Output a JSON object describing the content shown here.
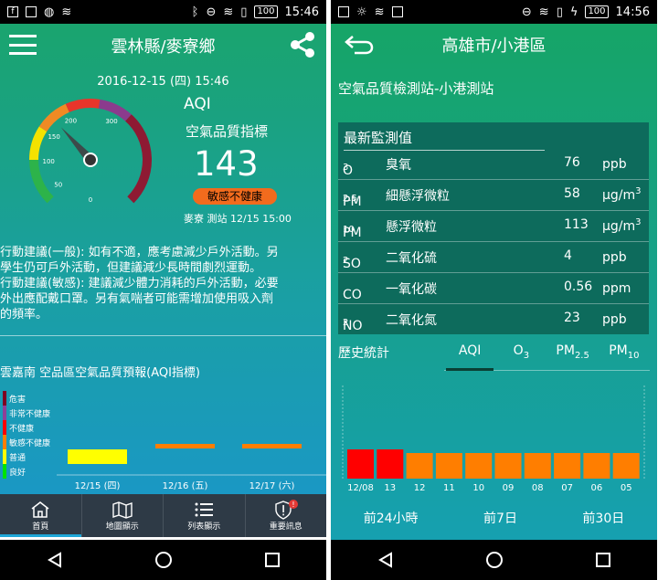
{
  "left": {
    "status": {
      "time": "15:46",
      "battery": "100"
    },
    "header": {
      "title": "雲林縣/麥寮鄉"
    },
    "datetime": "2016-12-15 (四) 15:46",
    "gauge": {
      "ticks": [
        "0",
        "50",
        "100",
        "150",
        "200",
        "300"
      ],
      "value": 143
    },
    "aqi": {
      "label": "AQI",
      "subtitle": "空氣品質指標",
      "value": "143",
      "badge": "敏感不健康",
      "station": "麥寮 測站 12/15 15:00"
    },
    "advice": [
      "行動建議(一般): 如有不適，應考慮減少戶外活動。另",
      "學生仍可戶外活動，但建議減少長時間劇烈運動。",
      "行動建議(敏感): 建議減少體力消耗的戶外活動，必要",
      "外出應配戴口罩。另有氣喘者可能需增加使用吸入劑",
      "的頻率。"
    ],
    "forecast": {
      "title": "雲嘉南 空品區空氣品質預報(AQI指標)",
      "legend": [
        "危害",
        "非常不健康",
        "不健康",
        "敏感不健康",
        "普通",
        "良好"
      ],
      "legend_colors": [
        "#7e0023",
        "#8f3f97",
        "#ff0000",
        "#ff7e00",
        "#ffff00",
        "#00e400"
      ],
      "colors": [
        "#ffff00",
        "#ff7e00",
        "#ff7e00"
      ],
      "levels": [
        "普通",
        "敏感不健康",
        "敏感不健康"
      ],
      "dates": [
        "12/15 (四)",
        "12/16 (五)",
        "12/17 (六)"
      ]
    },
    "tabs": [
      {
        "label": "首頁",
        "icon": "home-icon"
      },
      {
        "label": "地圖顯示",
        "icon": "map-icon"
      },
      {
        "label": "列表顯示",
        "icon": "list-icon"
      },
      {
        "label": "重要訊息",
        "icon": "alert-shield-icon",
        "badge": "!"
      }
    ]
  },
  "right": {
    "status": {
      "time": "14:56",
      "battery": "100"
    },
    "header": {
      "title": "高雄市/小港區"
    },
    "station_name": "空氣品質檢測站-小港測站",
    "panel_title": "最新監測值",
    "pollutants": [
      {
        "symbol": "O",
        "sub": "3",
        "name": "臭氧",
        "value": "76",
        "unit": "ppb",
        "sup": ""
      },
      {
        "symbol": "PM",
        "sub": "2.5",
        "name": "細懸浮微粒",
        "value": "58",
        "unit": "μg/m",
        "sup": "3"
      },
      {
        "symbol": "PM",
        "sub": "10",
        "name": "懸浮微粒",
        "value": "113",
        "unit": "μg/m",
        "sup": "3"
      },
      {
        "symbol": "SO",
        "sub": "2",
        "name": "二氧化硫",
        "value": "4",
        "unit": "ppb",
        "sup": ""
      },
      {
        "symbol": "CO",
        "sub": "",
        "name": "一氧化碳",
        "value": "0.56",
        "unit": "ppm",
        "sup": ""
      },
      {
        "symbol": "NO",
        "sub": "2",
        "name": "二氧化氮",
        "value": "23",
        "unit": "ppb",
        "sup": ""
      }
    ],
    "history_label": "歷史統計",
    "history_tabs": [
      {
        "main": "AQI",
        "sub": ""
      },
      {
        "main": "O",
        "sub": "3"
      },
      {
        "main": "PM",
        "sub": "2.5"
      },
      {
        "main": "PM",
        "sub": "10"
      }
    ],
    "history_labels": [
      "12/08",
      "13",
      "12",
      "11",
      "10",
      "09",
      "08",
      "07",
      "06",
      "05"
    ],
    "history_colors": [
      "#ff0000",
      "#ff0000",
      "#ff7e00",
      "#ff7e00",
      "#ff7e00",
      "#ff7e00",
      "#ff7e00",
      "#ff7e00",
      "#ff7e00",
      "#ff7e00"
    ],
    "ranges": [
      "前24小時",
      "前7日",
      "前30日"
    ]
  }
}
